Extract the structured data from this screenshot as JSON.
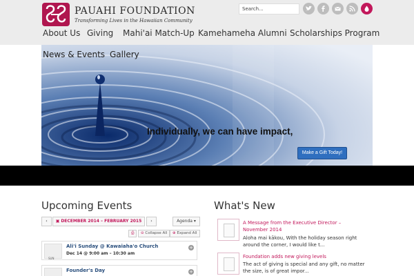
{
  "brand": {
    "name": "Pauahi Foundation",
    "tagline": "Transforming Lives in the Hawaiian Community",
    "accent_color": "#c2185b"
  },
  "search": {
    "placeholder": "Search..."
  },
  "social_icons": [
    "twitter-icon",
    "facebook-icon",
    "email-icon",
    "rss-icon",
    "give-drop-icon"
  ],
  "nav": {
    "items": [
      "About Us",
      "Giving",
      "Mahi'ai Match-Up",
      "Kamehameha Alumni",
      "Scholarships Program",
      "News & Events",
      "Gallery"
    ]
  },
  "hero": {
    "headline": "Individually, we can have impact,",
    "cta": "Make a Gift Today!"
  },
  "events": {
    "title": "Upcoming Events",
    "range": "DECEMBER 2014 – FEBRUARY 2015",
    "view": "Agenda",
    "collapse_label": "Collapse All",
    "expand_label": "Expand All",
    "items": [
      {
        "title": "Ali'i Sunday @ Kawaiaha'o Church",
        "time": "Dec 14 @ 9:00 am – 10:30 am",
        "day_label": "SUN"
      },
      {
        "title": "Founder's Day",
        "time": "",
        "day_label": ""
      }
    ]
  },
  "news": {
    "title": "What's New",
    "items": [
      {
        "title": "A Message from the Executive Director – November 2014",
        "excerpt": "Aloha mai kākou, With the holiday season right around the corner, I would like t..."
      },
      {
        "title": "Foundation adds new giving levels",
        "excerpt": "The act of giving is special and any gift, no matter the size, is of great impor..."
      }
    ]
  }
}
